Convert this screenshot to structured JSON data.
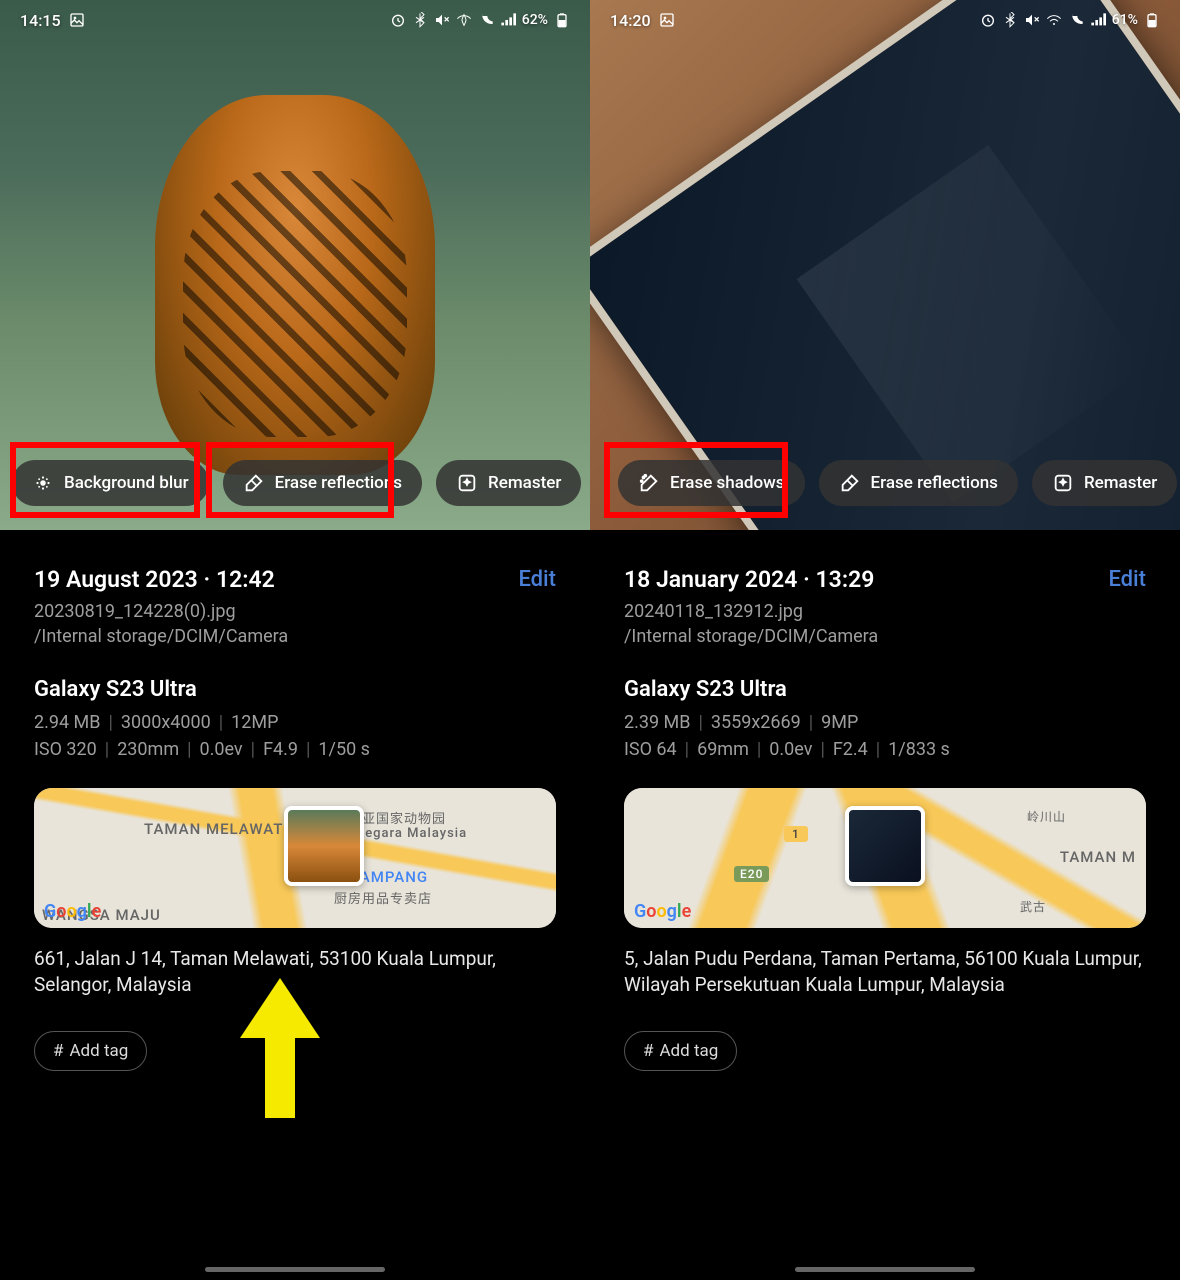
{
  "left": {
    "status": {
      "time": "14:15",
      "battery": "62%"
    },
    "pills": [
      {
        "label": "Background blur",
        "icon": "blur-icon"
      },
      {
        "label": "Erase reflections",
        "icon": "erase-reflections-icon"
      },
      {
        "label": "Remaster",
        "icon": "remaster-icon"
      }
    ],
    "date": "19 August 2023 · 12:42",
    "edit": "Edit",
    "filename": "20230819_124228(0).jpg",
    "filepath": "/Internal storage/DCIM/Camera",
    "device": "Galaxy S23 Ultra",
    "meta1": {
      "size": "2.94 MB",
      "res": "3000x4000",
      "mp": "12MP"
    },
    "meta2": {
      "iso": "ISO 320",
      "focal": "230mm",
      "ev": "0.0ev",
      "f": "F4.9",
      "shutter": "1/50 s"
    },
    "map_labels": {
      "a": "TAMAN MELAWATI",
      "b": "AS AMPANG",
      "c": "WANGSA MAJU",
      "poi1": "来西亚国家动物园",
      "poi2": "oo Negara Malaysia",
      "poi3": "厨房用品专卖店"
    },
    "address": "661, Jalan J 14, Taman Melawati, 53100 Kuala Lumpur, Selangor, Malaysia",
    "add_tag": "Add tag"
  },
  "right": {
    "status": {
      "time": "14:20",
      "battery": "61%"
    },
    "pills": [
      {
        "label": "Erase shadows",
        "icon": "erase-shadows-icon"
      },
      {
        "label": "Erase reflections",
        "icon": "erase-reflections-icon"
      },
      {
        "label": "Remaster",
        "icon": "remaster-icon"
      }
    ],
    "date": "18 January 2024 · 13:29",
    "edit": "Edit",
    "filename": "20240118_132912.jpg",
    "filepath": "/Internal storage/DCIM/Camera",
    "device": "Galaxy S23 Ultra",
    "meta1": {
      "size": "2.39 MB",
      "res": "3559x2669",
      "mp": "9MP"
    },
    "meta2": {
      "iso": "ISO 64",
      "focal": "69mm",
      "ev": "0.0ev",
      "f": "F2.4",
      "shutter": "1/833 s"
    },
    "map_labels": {
      "a": "E20",
      "b": "TAMAN M",
      "c": "1",
      "d": "岭川山",
      "e": "武古"
    },
    "address": "5, Jalan Pudu Perdana, Taman Pertama, 56100 Kuala Lumpur, Wilayah Persekutuan Kuala Lumpur, Malaysia",
    "add_tag": "Add tag"
  }
}
